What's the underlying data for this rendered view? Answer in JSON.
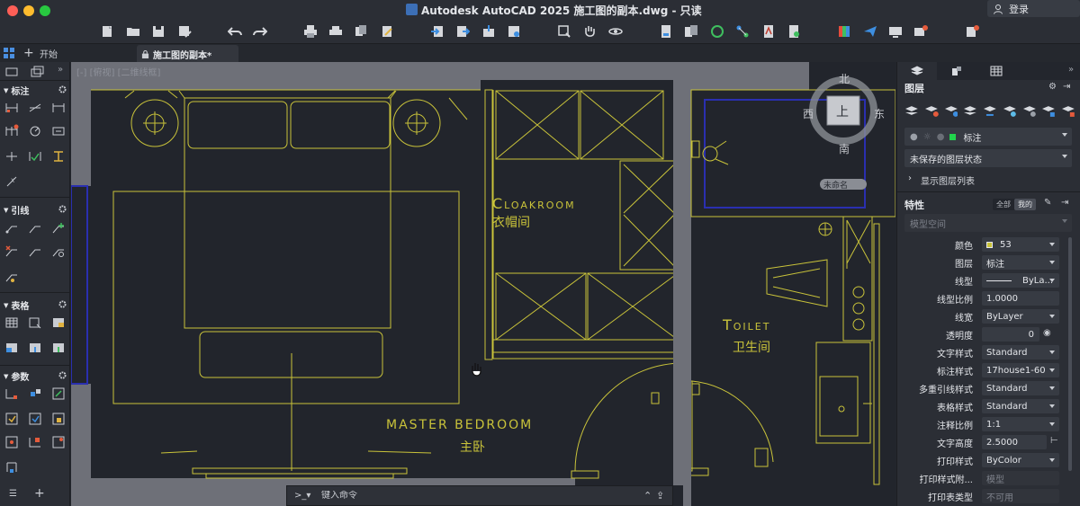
{
  "window": {
    "title": "Autodesk AutoCAD 2025   施工图的副本.dwg - 只读",
    "login_label": "登录"
  },
  "tabs": {
    "start": "开始",
    "document": "施工图的副本*"
  },
  "viewport": {
    "view_label": "[-] [俯视] [二维线框]"
  },
  "left_panel": {
    "sections": [
      {
        "label": "标注"
      },
      {
        "label": "引线"
      },
      {
        "label": "表格"
      },
      {
        "label": "参数"
      }
    ]
  },
  "drawing": {
    "rooms": [
      {
        "name_en": "Cloakroom",
        "name_zh": "衣帽间"
      },
      {
        "name_en": "Toilet",
        "name_zh": "卫生间"
      },
      {
        "name_en": "MASTER BEDROOM",
        "name_zh": "主卧"
      }
    ],
    "viewcube": {
      "north": "北",
      "south": "南",
      "west": "西",
      "east": "东",
      "face": "上",
      "ucs_label": "未命名"
    },
    "colors": {
      "line": "#c9c33a",
      "background": "#22252c",
      "wall": "#6e7078",
      "selection": "#2a2fb0"
    }
  },
  "command_line": {
    "placeholder": "键入命令"
  },
  "right_panel": {
    "layers_title": "图层",
    "current_layer": "标注",
    "layer_state": "未保存的图层状态",
    "show_layer_list": "显示图层列表",
    "properties_title": "特性",
    "filter_all": "全部",
    "filter_mine": "我的",
    "space": "模型空间",
    "properties": [
      {
        "label": "颜色",
        "value": "53"
      },
      {
        "label": "图层",
        "value": "标注"
      },
      {
        "label": "线型",
        "value": "ByLa..."
      },
      {
        "label": "线型比例",
        "value": "1.0000"
      },
      {
        "label": "线宽",
        "value": "ByLayer"
      },
      {
        "label": "透明度",
        "value": "0"
      },
      {
        "label": "文字样式",
        "value": "Standard"
      },
      {
        "label": "标注样式",
        "value": "17house1-60"
      },
      {
        "label": "多重引线样式",
        "value": "Standard"
      },
      {
        "label": "表格样式",
        "value": "Standard"
      },
      {
        "label": "注释比例",
        "value": "1:1"
      },
      {
        "label": "文字高度",
        "value": "2.5000"
      },
      {
        "label": "打印样式",
        "value": "ByColor"
      },
      {
        "label": "打印样式附...",
        "value": "模型"
      },
      {
        "label": "打印表类型",
        "value": "不可用"
      }
    ]
  }
}
